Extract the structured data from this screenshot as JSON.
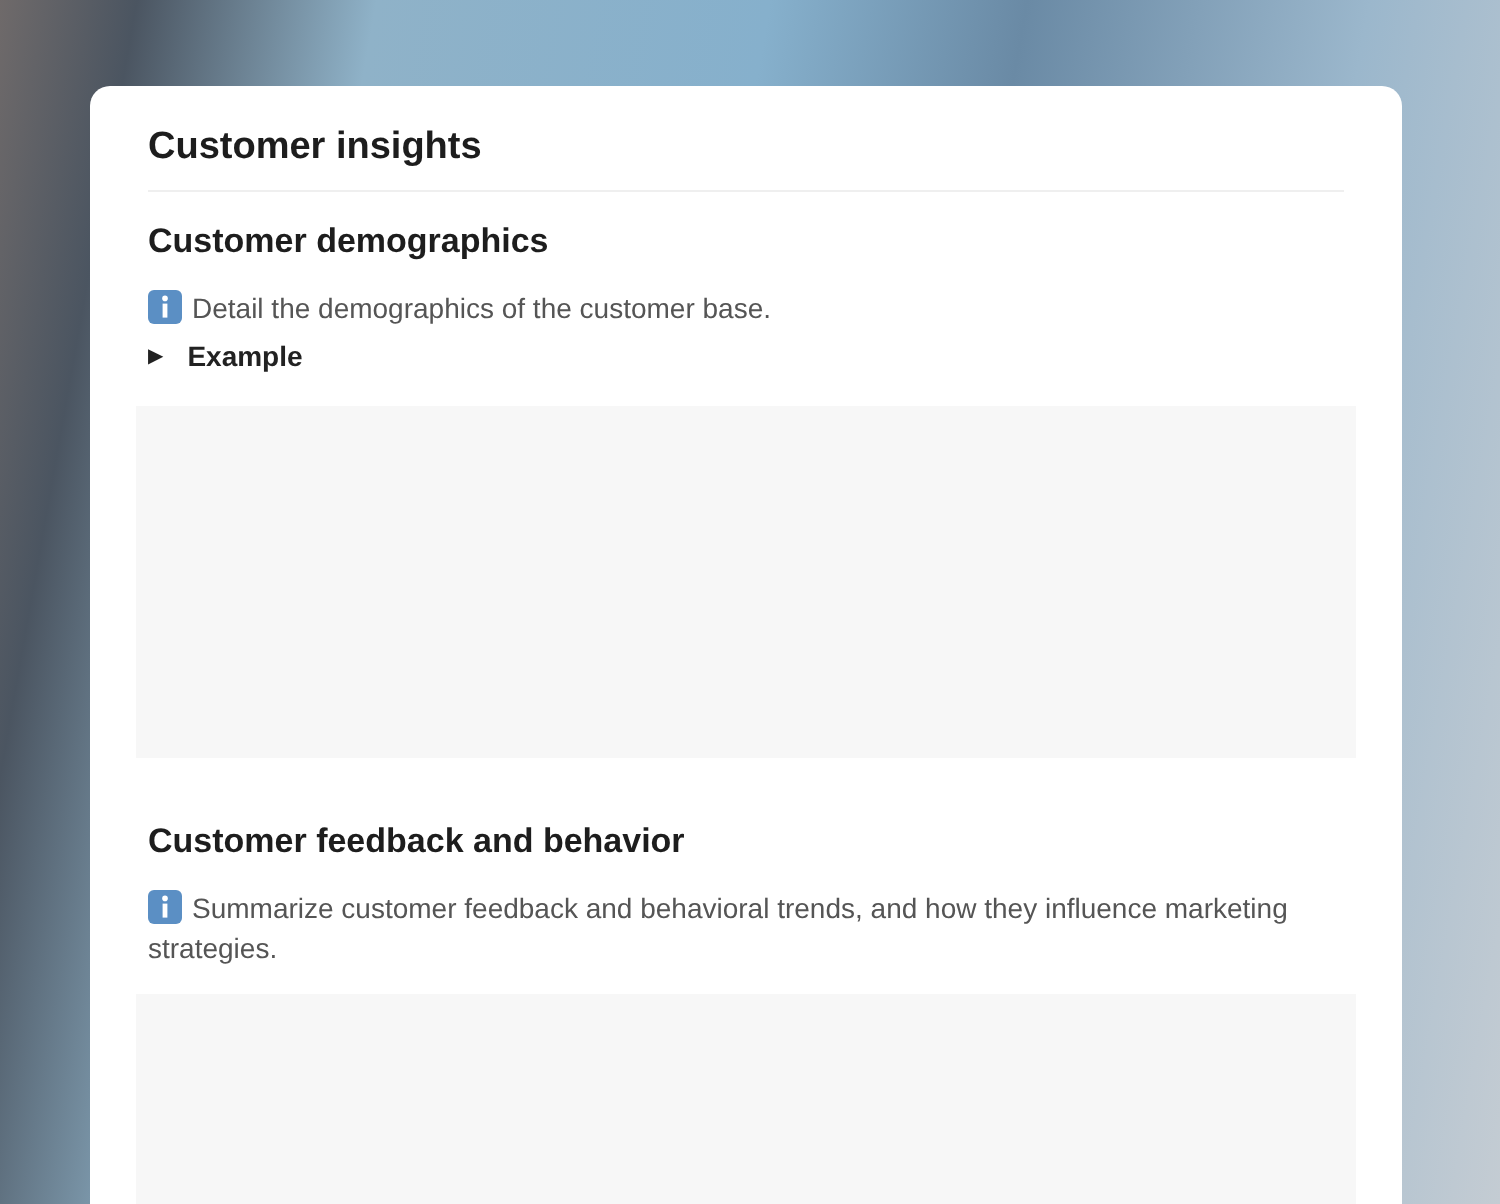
{
  "page": {
    "title": "Customer insights"
  },
  "sections": [
    {
      "heading": "Customer demographics",
      "description": "Detail the demographics of the customer base.",
      "toggle": {
        "marker": "▶",
        "label": "Example",
        "expanded": false
      }
    },
    {
      "heading": "Customer feedback and behavior",
      "description": "Summarize customer feedback and behavioral trends, and how they influence marketing strategies."
    }
  ]
}
